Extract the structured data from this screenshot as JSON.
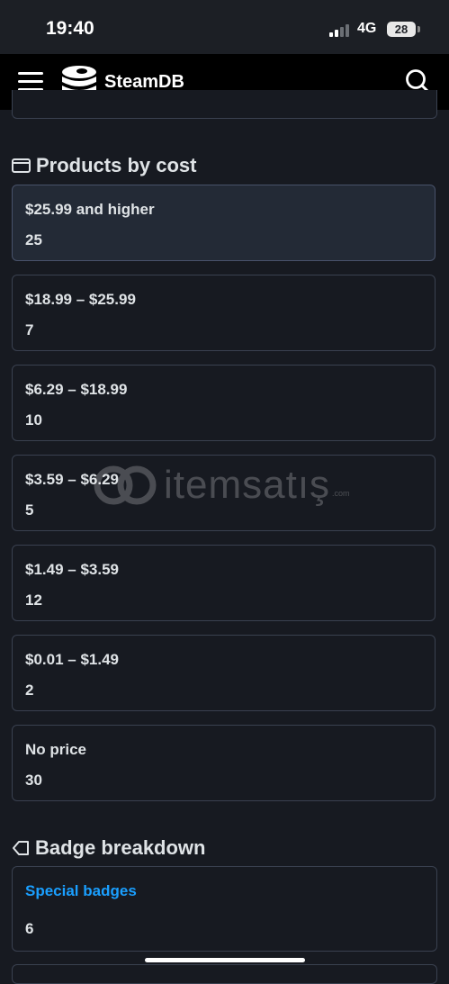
{
  "status": {
    "time": "19:40",
    "network": "4G",
    "battery": "28"
  },
  "navbar": {
    "brand": "SteamDB"
  },
  "products_section": {
    "title": "Products by cost",
    "items": [
      {
        "label": "$25.99 and higher",
        "count": "25"
      },
      {
        "label": "$18.99 – $25.99",
        "count": "7"
      },
      {
        "label": "$6.29 – $18.99",
        "count": "10"
      },
      {
        "label": "$3.59 – $6.29",
        "count": "5"
      },
      {
        "label": "$1.49 – $3.59",
        "count": "12"
      },
      {
        "label": "$0.01 – $1.49",
        "count": "2"
      },
      {
        "label": "No price",
        "count": "30"
      }
    ]
  },
  "badge_section": {
    "title": "Badge breakdown",
    "special_label": "Special badges",
    "special_count": "6"
  },
  "watermark": {
    "text": "itemsatış",
    "suffix": ".com"
  },
  "colors": {
    "background": "#171a21",
    "link": "#1a9fff",
    "card_border": "#3a4150"
  }
}
